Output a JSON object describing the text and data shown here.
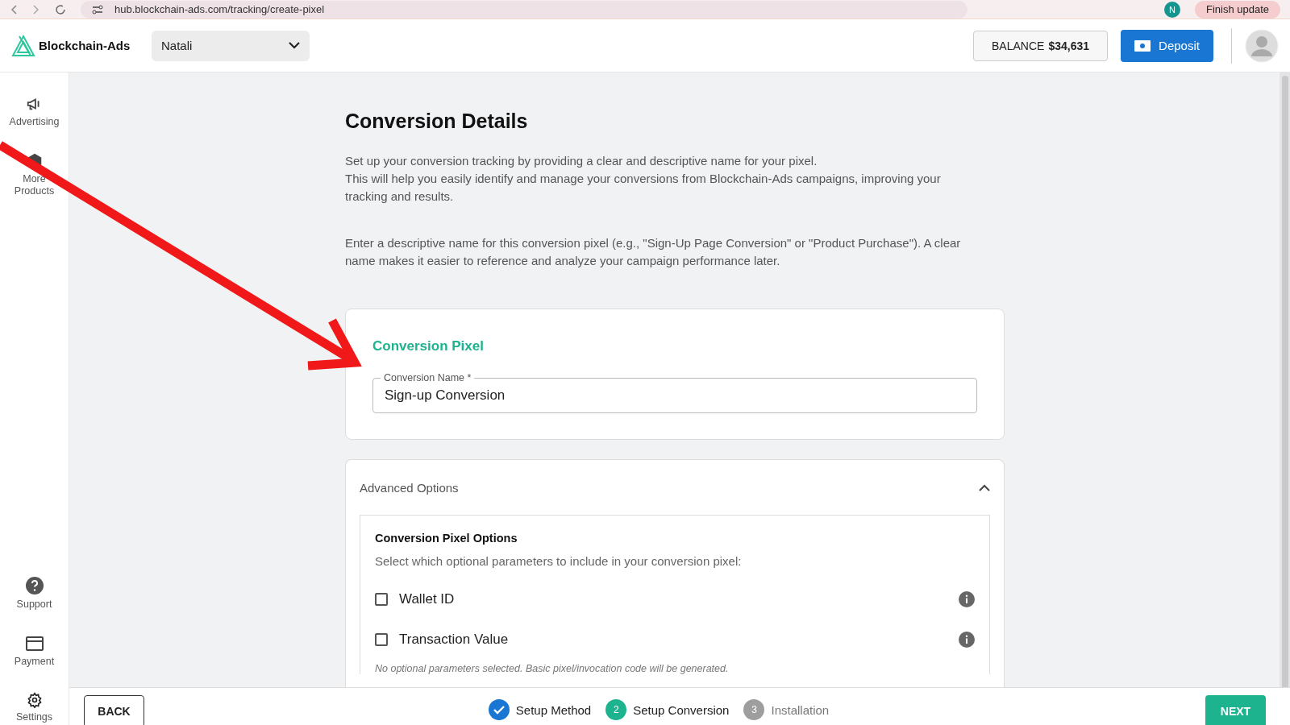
{
  "browser": {
    "url": "hub.blockchain-ads.com/tracking/create-pixel",
    "update_button": "Finish update",
    "profile_initial": "N"
  },
  "header": {
    "logo_text": "Blockchain-Ads",
    "account_select": {
      "value": "Natali"
    },
    "balance_label": "BALANCE",
    "balance_value": "$34,631",
    "deposit_button": "Deposit"
  },
  "sidebar": {
    "top_items": [
      {
        "label": "Advertising"
      },
      {
        "label": "More Products"
      }
    ],
    "bottom_items": [
      {
        "label": "Support"
      },
      {
        "label": "Payment"
      },
      {
        "label": "Settings"
      }
    ]
  },
  "page": {
    "title": "Conversion Details",
    "intro": [
      "Set up your conversion tracking by providing a clear and descriptive name for your pixel.",
      "This will help you easily identify and manage your conversions from Blockchain-Ads campaigns, improving your tracking and results."
    ],
    "hint": "Enter a descriptive name for this conversion pixel (e.g., \"Sign-Up Page Conversion\" or \"Product Purchase\"). A clear name makes it easier to reference and analyze your campaign performance later.",
    "pixel_card": {
      "title": "Conversion Pixel",
      "field_label": "Conversion Name *",
      "field_value": "Sign-up Conversion"
    },
    "advanced": {
      "title": "Advanced Options",
      "expanded": true,
      "options_title": "Conversion Pixel Options",
      "options_subtitle": "Select which optional parameters to include in your conversion pixel:",
      "options": [
        {
          "label": "Wallet ID",
          "checked": false
        },
        {
          "label": "Transaction Value",
          "checked": false
        }
      ],
      "note": "No optional parameters selected. Basic pixel/invocation code will be generated."
    }
  },
  "footer": {
    "back_button": "BACK",
    "next_button": "NEXT",
    "steps": [
      {
        "label": "Setup Method",
        "completed": true,
        "selected": false
      },
      {
        "number": "2",
        "label": "Setup Conversion",
        "completed": false,
        "selected": true
      },
      {
        "number": "3",
        "label": "Installation",
        "completed": false,
        "selected": false
      }
    ]
  }
}
